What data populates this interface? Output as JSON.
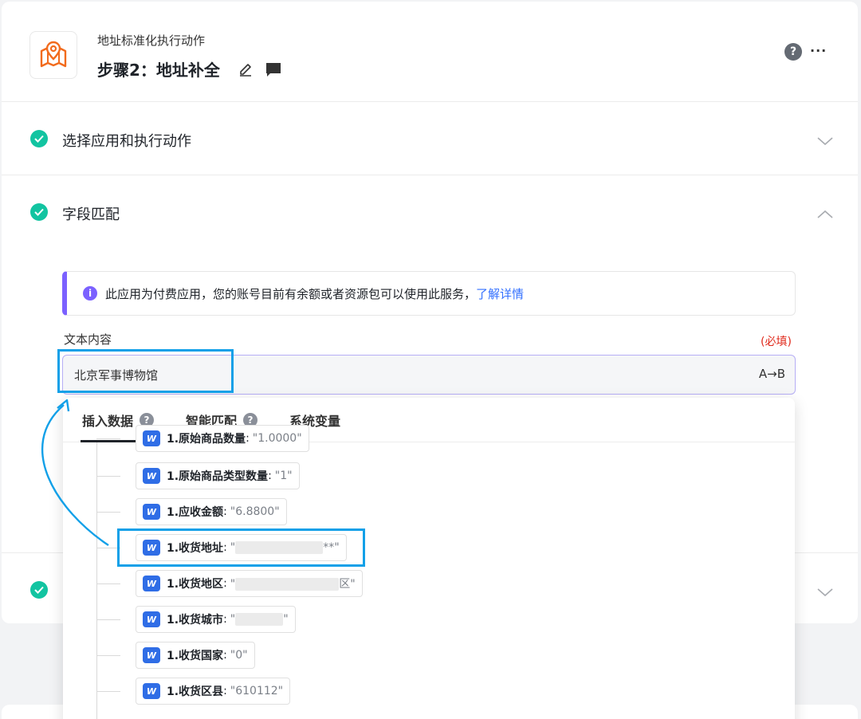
{
  "header": {
    "subtitle": "地址标准化执行动作",
    "title": "步骤2：地址补全",
    "help": "?",
    "more": "···"
  },
  "sections": [
    {
      "title": "选择应用和执行动作",
      "status": "done",
      "expanded": false
    },
    {
      "title": "字段匹配",
      "status": "done",
      "expanded": true
    },
    {
      "title": "",
      "status": "done",
      "expanded": false
    }
  ],
  "notice": {
    "info": "i",
    "text": "此应用为付费应用，您的账号目前有余额或者资源包可以使用此服务，",
    "link": "了解详情"
  },
  "field": {
    "label": "文本内容",
    "required": "(必填)",
    "value": "北京军事博物馆",
    "transform": "A→B"
  },
  "dropdown": {
    "tabs": [
      {
        "label": "插入数据",
        "help": "?"
      },
      {
        "label": "智能匹配",
        "help": "?"
      },
      {
        "label": "系统变量",
        "help": ""
      }
    ],
    "items": [
      {
        "key": "1.原始商品数量",
        "value": "\"1.0000\"",
        "masked": false
      },
      {
        "key": "1.原始商品类型数量",
        "value": "\"1\"",
        "masked": false
      },
      {
        "key": "1.应收金额",
        "value": "\"6.8800\"",
        "masked": false
      },
      {
        "key": "1.收货地址",
        "value_prefix": "\"",
        "value_suffix": "**\"",
        "masked": true
      },
      {
        "key": "1.收货地区",
        "value_prefix": "\"",
        "value_suffix": "区\"",
        "masked": true
      },
      {
        "key": "1.收货城市",
        "value_prefix": "\"",
        "value_suffix": "\"",
        "masked": true
      },
      {
        "key": "1.收货国家",
        "value": "\"0\"",
        "masked": false
      },
      {
        "key": "1.收货区县",
        "value": "\"610112\"",
        "masked": false
      }
    ],
    "chip_icon": "W"
  },
  "colors": {
    "accent": "#12a0e8",
    "success": "#12c4a1",
    "notice_bar": "#7b61ff",
    "link": "#3370ff",
    "required": "#e0291b",
    "chip_icon_bg": "#2f6de6",
    "logo": "#f26b1d"
  }
}
